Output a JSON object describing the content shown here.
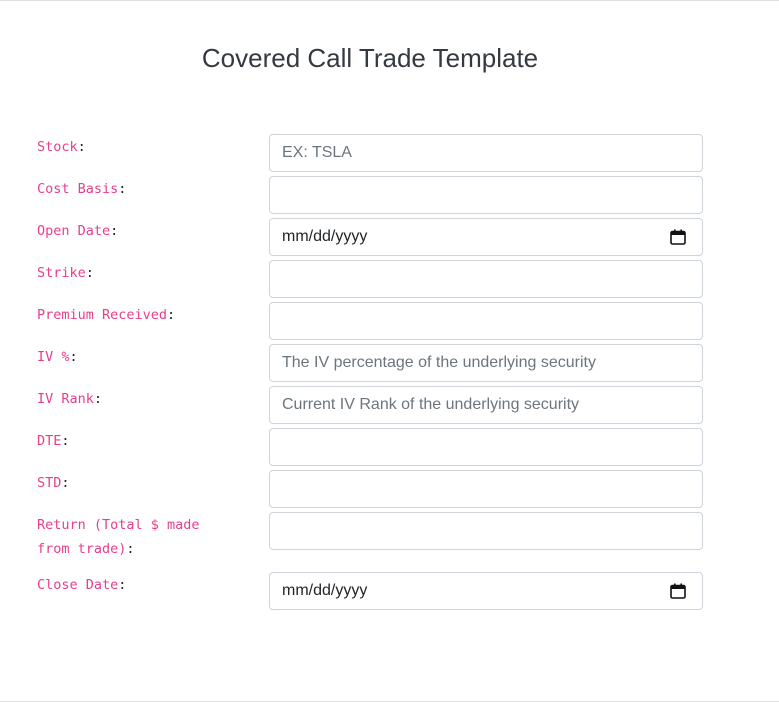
{
  "page": {
    "title": "Covered Call Trade Template"
  },
  "form": {
    "fields": [
      {
        "label": "Stock",
        "type": "text",
        "value": "",
        "placeholder": "EX: TSLA"
      },
      {
        "label": "Cost Basis",
        "type": "text",
        "value": "",
        "placeholder": ""
      },
      {
        "label": "Open Date",
        "type": "date",
        "value": "mm/dd/yyyy",
        "icon": "calendar-icon"
      },
      {
        "label": "Strike",
        "type": "text",
        "value": "",
        "placeholder": ""
      },
      {
        "label": "Premium Received",
        "type": "text",
        "value": "",
        "placeholder": ""
      },
      {
        "label": "IV %",
        "type": "text",
        "value": "",
        "placeholder": "The IV percentage of the underlying security"
      },
      {
        "label": "IV Rank",
        "type": "text",
        "value": "",
        "placeholder": "Current IV Rank of the underlying security"
      },
      {
        "label": "DTE",
        "type": "text",
        "value": "",
        "placeholder": ""
      },
      {
        "label": "STD",
        "type": "text",
        "value": "",
        "placeholder": ""
      },
      {
        "label": "Return (Total $ made from trade)",
        "type": "text",
        "value": "",
        "placeholder": ""
      },
      {
        "label": "Close Date",
        "type": "date",
        "value": "mm/dd/yyyy",
        "icon": "calendar-icon"
      }
    ],
    "label_suffix": ":"
  },
  "colors": {
    "label_accent": "#e83e8c",
    "input_border": "#ced4da",
    "placeholder": "#6c757d"
  }
}
